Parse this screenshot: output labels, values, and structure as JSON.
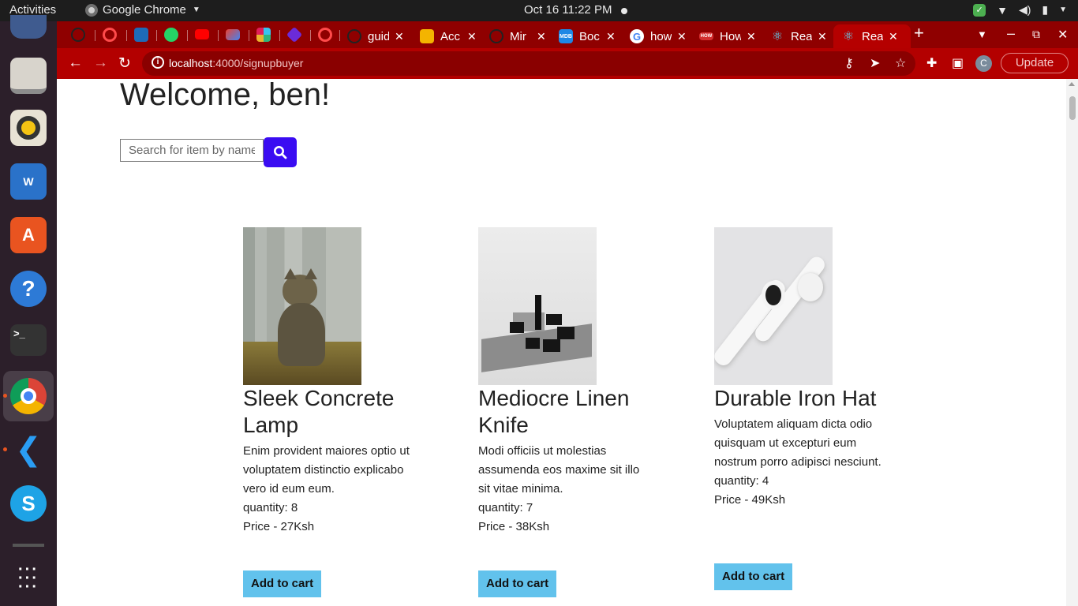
{
  "topbar": {
    "activities": "Activities",
    "app_name": "Google Chrome",
    "clock": "Oct 16  11:22 PM"
  },
  "dock": {
    "apps": [
      "thunderbird-icon",
      "files-icon",
      "rhythmbox-icon",
      "libreoffice-writer-icon",
      "app-center-icon",
      "help-icon",
      "terminal-icon",
      "chrome-icon",
      "vscode-icon",
      "skype-icon",
      "show-apps-icon"
    ]
  },
  "tabs": [
    {
      "title": "guid",
      "favicon_color": "#222222"
    },
    {
      "title": "Acc",
      "favicon_color": "#f4b400"
    },
    {
      "title": "Mir",
      "favicon_color": "#222222"
    },
    {
      "title": "Boc",
      "favicon_color": "#1e88e5"
    },
    {
      "title": "how",
      "favicon_color": "#ffffff"
    },
    {
      "title": "How",
      "favicon_color": "#d32f2f"
    },
    {
      "title": "Rea",
      "favicon_color": "#61dafb"
    },
    {
      "title": "Rea",
      "favicon_color": "#61dafb"
    }
  ],
  "browser": {
    "url_host": "localhost",
    "url_path": ":4000/signupbuyer",
    "profile_initial": "C",
    "update_label": "Update"
  },
  "page": {
    "welcome": "Welcome, ben!",
    "search_placeholder": "Search for item by name"
  },
  "products": [
    {
      "name": "Sleek Concrete Lamp",
      "description": "Enim provident maiores optio ut voluptatem distinctio explicabo vero id eum eum.",
      "quantity": "quantity: 8",
      "price": "Price - 27Ksh",
      "button": "Add to cart"
    },
    {
      "name": "Mediocre Linen Knife",
      "description": "Modi officiis ut molestias assumenda eos maxime sit illo sit vitae minima.",
      "quantity": "quantity: 7",
      "price": "Price - 38Ksh",
      "button": "Add to cart"
    },
    {
      "name": "Durable Iron Hat",
      "description": "Voluptatem aliquam dicta odio quisquam ut excepturi eum nostrum porro adipisci nesciunt.",
      "quantity": "quantity: 4",
      "price": "Price - 49Ksh",
      "button": "Add to cart"
    }
  ],
  "colors": {
    "tabstrip": "#8f0000",
    "toolbar": "#b30000",
    "search_button": "#3a0cf2",
    "add_to_cart": "#62c2ec"
  }
}
